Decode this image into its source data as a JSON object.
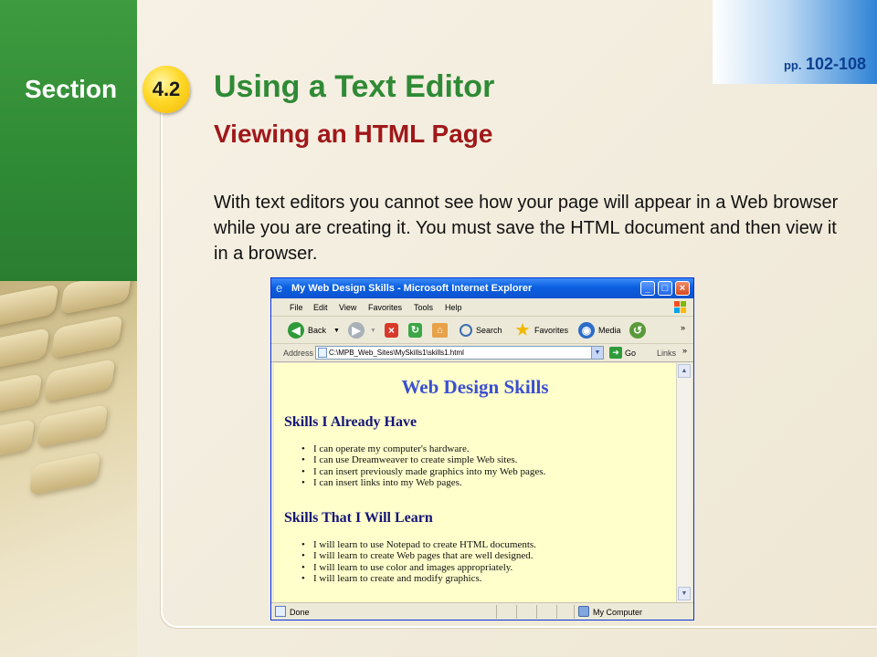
{
  "slide": {
    "section_label": "Section",
    "section_number": "4.2",
    "page_ref_prefix": "pp.",
    "page_ref_range": "102-108",
    "title": "Using a Text Editor",
    "subtitle": "Viewing an HTML Page",
    "body": "With text editors you cannot see how your page will appear in a Web browser while you are creating it. You must save the HTML document and then view it in a browser.",
    "colors": {
      "green": "#2f8a35",
      "title_green": "#2f8a35",
      "subtitle_red": "#a0181a",
      "badge_yellow": "#ffd92a",
      "ref_blue": "#0b3f8f"
    }
  },
  "browser": {
    "window_title": "My Web Design Skills - Microsoft Internet Explorer",
    "window_controls": [
      "minimize",
      "maximize",
      "close"
    ],
    "menu": [
      "File",
      "Edit",
      "View",
      "Favorites",
      "Tools",
      "Help"
    ],
    "toolbar": {
      "back": "Back",
      "search": "Search",
      "favorites": "Favorites",
      "media": "Media",
      "more": "»"
    },
    "address": {
      "label": "Address",
      "value": "C:\\MPB_Web_Sites\\MySkills1\\skills1.html",
      "go": "Go",
      "links": "Links",
      "more": "»"
    },
    "page": {
      "title": "Web Design Skills",
      "section1_heading": "Skills I Already Have",
      "section1_items": [
        "I can operate my computer's hardware.",
        "I can use Dreamweaver to create simple Web sites.",
        "I can insert previously made graphics into my Web pages.",
        "I can insert links into my Web pages."
      ],
      "section2_heading": "Skills That I Will Learn",
      "section2_items": [
        "I will learn to use Notepad to create HTML documents.",
        "I will learn to create Web pages that are well designed.",
        "I will learn to use color and images appropriately.",
        "I will learn to create and modify graphics."
      ]
    },
    "status": {
      "left": "Done",
      "zone": "My Computer"
    },
    "icons": [
      "ie-logo-icon",
      "back-arrow-icon",
      "forward-arrow-icon",
      "stop-icon",
      "refresh-icon",
      "home-icon",
      "search-icon",
      "favorites-star-icon",
      "media-icon",
      "history-icon",
      "page-icon",
      "go-arrow-icon",
      "computer-icon",
      "windows-logo-icon"
    ]
  }
}
